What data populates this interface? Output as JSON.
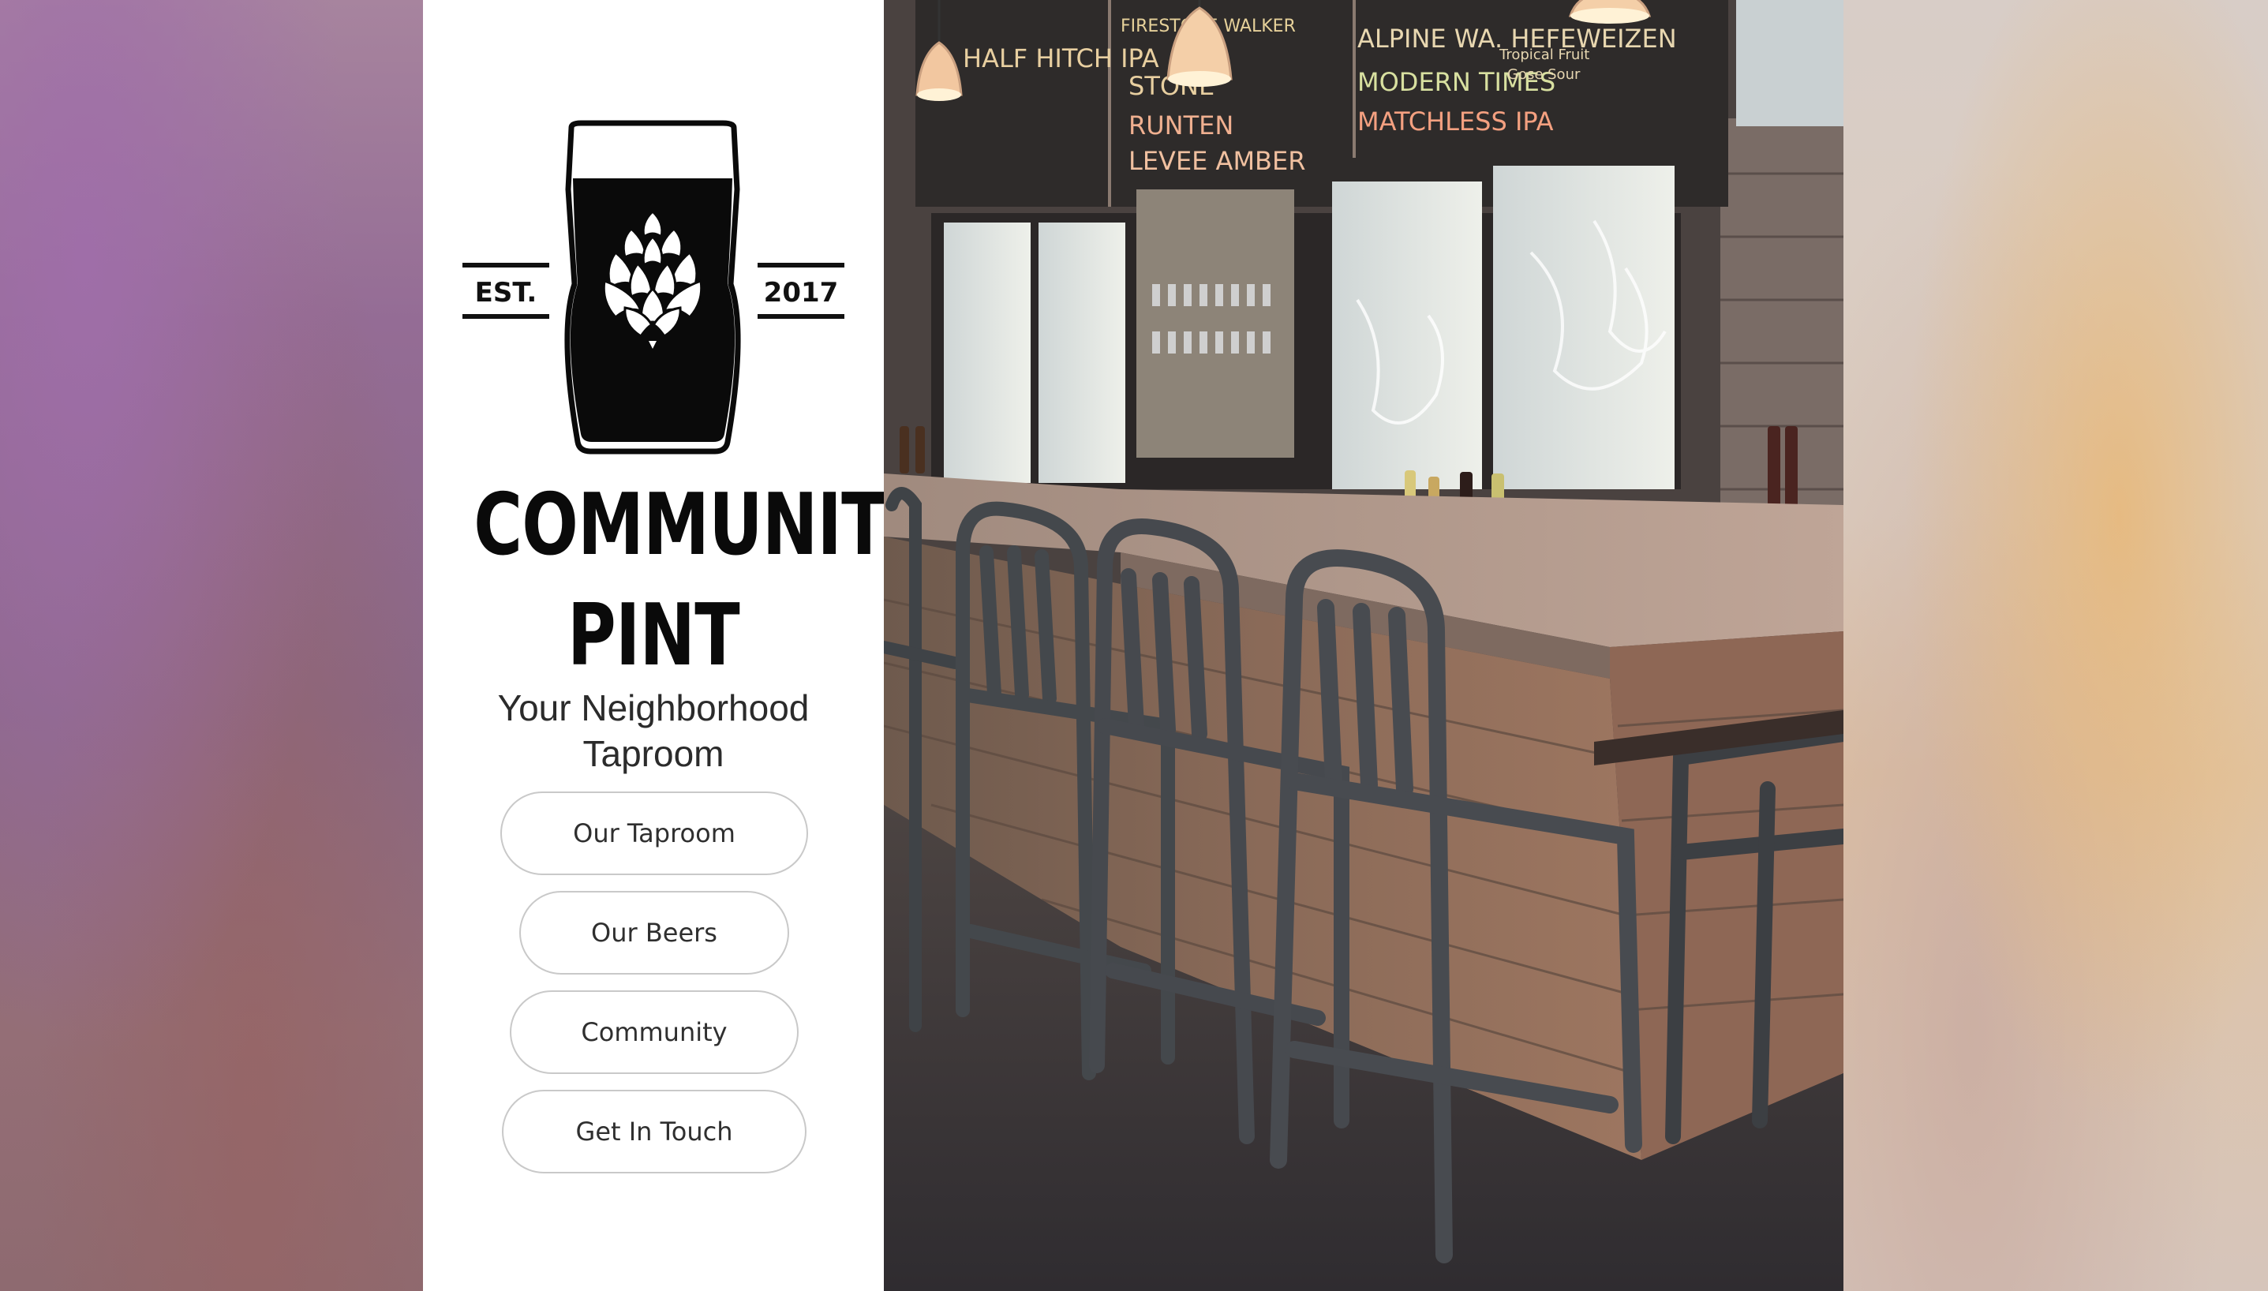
{
  "logo": {
    "est_label": "EST.",
    "year": "2017",
    "icon": "pint-glass-with-hop"
  },
  "brand": {
    "line1": "COMMUNITY",
    "line2": "PINT"
  },
  "tagline": {
    "line1": "Your Neighborhood",
    "line2": "Taproom"
  },
  "nav": {
    "taproom": "Our Taproom",
    "beers": "Our Beers",
    "community": "Community",
    "contact": "Get In Touch"
  },
  "photo": {
    "subject": "taproom bar with stools and tap wall",
    "menu_lines": [
      "HALF HITCH IPA",
      "FIRESTONE WALKER",
      "STONE",
      "RUNTEN",
      "LEVEE AMBER",
      "ALPINE WA. HEFEWEIZEN",
      "MODERN TIMES",
      "MATCHLESS IPA",
      "Tropical Fruit",
      "Gose Sour"
    ]
  },
  "colors": {
    "panel_bg": "#ffffff",
    "brand_text": "#0a0a0a",
    "button_border": "#c9c9c9",
    "bg_left": "#946f96",
    "bg_right": "#dcc3a3"
  }
}
